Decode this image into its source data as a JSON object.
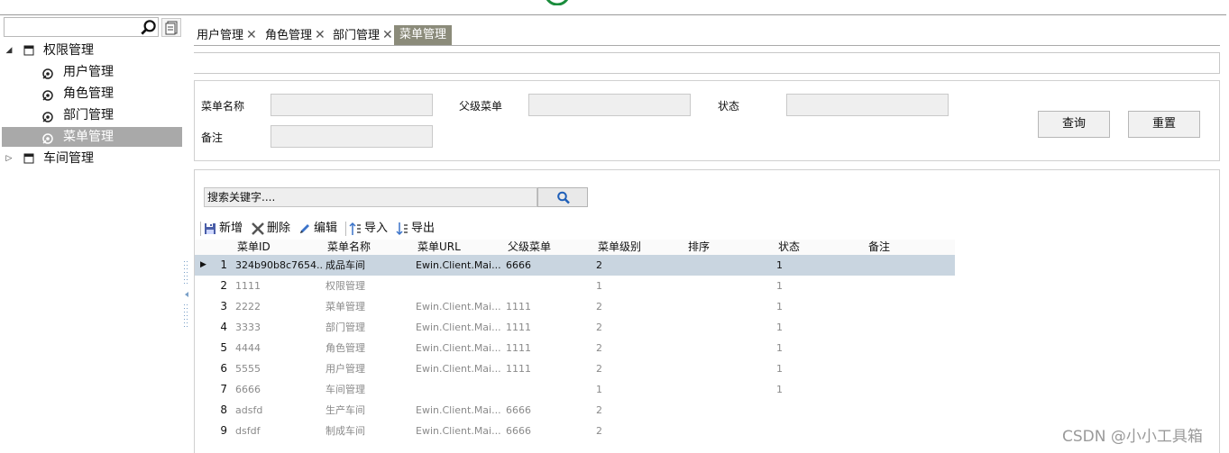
{
  "tree": {
    "nodes": [
      {
        "label": "权限管理",
        "arrow": "◢",
        "level": 0
      },
      {
        "label": "用户管理",
        "level": 1
      },
      {
        "label": "角色管理",
        "level": 1
      },
      {
        "label": "部门管理",
        "level": 1
      },
      {
        "label": "菜单管理",
        "level": 1,
        "selected": true
      },
      {
        "label": "车间管理",
        "arrow": "▷",
        "level": 0
      }
    ]
  },
  "tabs": [
    {
      "label": "用户管理",
      "close": "✕"
    },
    {
      "label": "角色管理",
      "close": "✕"
    },
    {
      "label": "部门管理",
      "close": "✕"
    },
    {
      "label": "菜单管理",
      "active": true
    }
  ],
  "filter": {
    "menu_name_label": "菜单名称",
    "parent_menu_label": "父级菜单",
    "status_label": "状态",
    "remark_label": "备注",
    "query_button": "查询",
    "reset_button": "重置"
  },
  "grid": {
    "search_placeholder": "搜索关键字....",
    "toolbar": {
      "add": "新增",
      "delete": "删除",
      "edit": "编辑",
      "import": "导入",
      "export": "导出"
    },
    "columns": [
      "菜单ID",
      "菜单名称",
      "菜单URL",
      "父级菜单",
      "菜单级别",
      "排序",
      "状态",
      "备注"
    ],
    "rows": [
      {
        "no": "1",
        "id": "324b90b8c7654...",
        "name": "成品车间",
        "url": "Ewin.Client.Mai...",
        "parent": "6666",
        "level": "2",
        "sort": "",
        "status": "1",
        "remark": "",
        "selected": true
      },
      {
        "no": "2",
        "id": "1111",
        "name": "权限管理",
        "url": "",
        "parent": "",
        "level": "1",
        "sort": "",
        "status": "1",
        "remark": ""
      },
      {
        "no": "3",
        "id": "2222",
        "name": "菜单管理",
        "url": "Ewin.Client.Mai...",
        "parent": "1111",
        "level": "2",
        "sort": "",
        "status": "1",
        "remark": ""
      },
      {
        "no": "4",
        "id": "3333",
        "name": "部门管理",
        "url": "Ewin.Client.Mai...",
        "parent": "1111",
        "level": "2",
        "sort": "",
        "status": "1",
        "remark": ""
      },
      {
        "no": "5",
        "id": "4444",
        "name": "角色管理",
        "url": "Ewin.Client.Mai...",
        "parent": "1111",
        "level": "2",
        "sort": "",
        "status": "1",
        "remark": ""
      },
      {
        "no": "6",
        "id": "5555",
        "name": "用户管理",
        "url": "Ewin.Client.Mai...",
        "parent": "1111",
        "level": "2",
        "sort": "",
        "status": "1",
        "remark": ""
      },
      {
        "no": "7",
        "id": "6666",
        "name": "车间管理",
        "url": "",
        "parent": "",
        "level": "1",
        "sort": "",
        "status": "1",
        "remark": ""
      },
      {
        "no": "8",
        "id": "adsfd",
        "name": "生产车间",
        "url": "Ewin.Client.Mai...",
        "parent": "6666",
        "level": "2",
        "sort": "",
        "status": "",
        "remark": ""
      },
      {
        "no": "9",
        "id": "dsfdf",
        "name": "制成车间",
        "url": "Ewin.Client.Mai...",
        "parent": "6666",
        "level": "2",
        "sort": "",
        "status": "",
        "remark": ""
      }
    ],
    "row_indicator": "▶"
  },
  "watermark": "CSDN @小小工具箱",
  "colors": {
    "selected_tree": "#a9a9a9",
    "active_tab": "#8b8b7a",
    "selected_row": "#c9d5e0",
    "search_icon": "#1f5fb8"
  }
}
